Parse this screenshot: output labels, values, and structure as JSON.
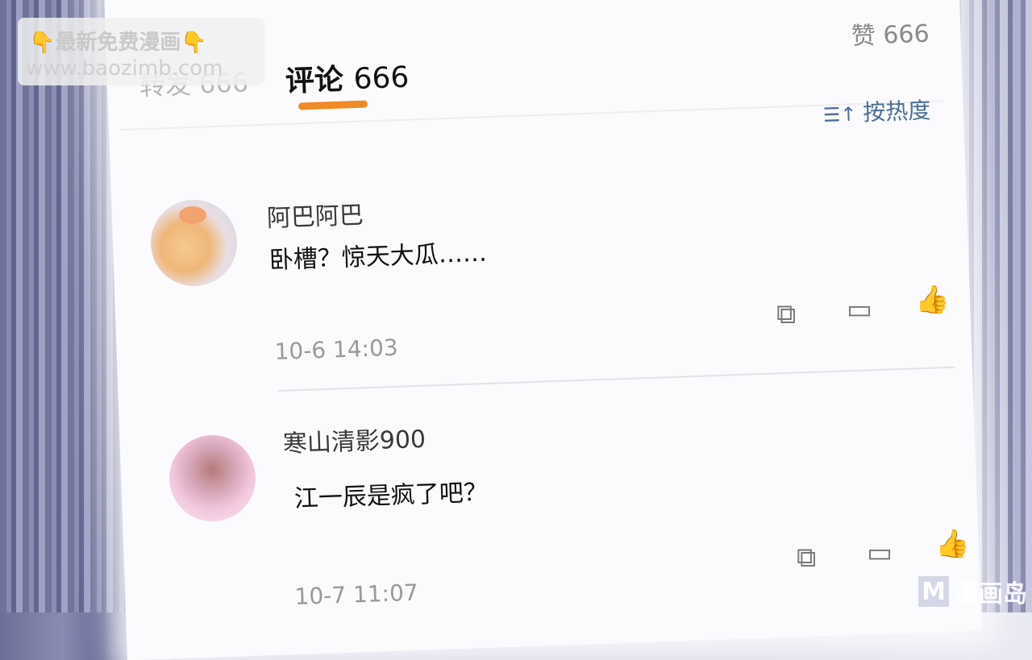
{
  "watermark": {
    "line1": "👇最新免费漫画👇",
    "line2": "www.baozimb.com"
  },
  "header": {
    "like_label": "赞 666",
    "repost_tab": "转发 666",
    "comments_tab_label": "评论",
    "comments_tab_count": "666",
    "sort_label": "按热度",
    "accent_color": "#f08a24"
  },
  "comments": [
    {
      "username": "阿巴阿巴",
      "text": "卧槽？惊天大瓜……",
      "timestamp": "10-6 14:03"
    },
    {
      "username": "寒山清影900",
      "text": "江一辰是疯了吧？",
      "timestamp": "10-7 11:07"
    }
  ],
  "icons": {
    "share": "↗",
    "comment": "💬",
    "like": "👍",
    "sort": "⇅"
  },
  "logo": {
    "mark": "M",
    "text": "漫画岛"
  }
}
